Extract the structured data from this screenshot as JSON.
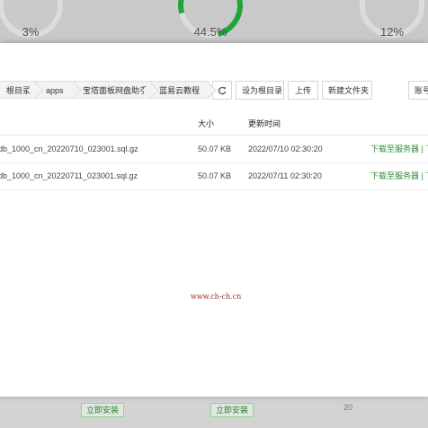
{
  "dashboard": {
    "gauges": [
      {
        "label": "3%",
        "percent": 3,
        "color": "#20a53a"
      },
      {
        "label": "44.5%",
        "percent": 44.5,
        "color": "#20a53a"
      },
      {
        "label": "12%",
        "percent": 12,
        "color": "#20a53a"
      }
    ],
    "bottom_buttons": [
      "立即安装",
      "立即安装"
    ],
    "bottom_number": "20"
  },
  "modal": {
    "breadcrumb": [
      "根目录",
      "apps",
      "宝塔面板网盘助手",
      "蓝易云教程"
    ],
    "toolbar": {
      "refresh_icon": "refresh-icon",
      "set_root": "设为根目录",
      "upload": "上传",
      "new_folder": "新建文件夹",
      "right_partial": "账号"
    },
    "table": {
      "columns": [
        "",
        "大小",
        "更新时间",
        ""
      ],
      "rows": [
        {
          "name": "db_1000_cn_20220710_023001.sql.gz",
          "size": "50.07 KB",
          "time": "2022/07/10 02:30:20",
          "action": "下载至服务器 | 下"
        },
        {
          "name": "db_1000_cn_20220711_023001.sql.gz",
          "size": "50.07 KB",
          "time": "2022/07/11 02:30:20",
          "action": "下载至服务器 | 下"
        }
      ]
    },
    "watermark": "www.ch-ch.cn"
  }
}
